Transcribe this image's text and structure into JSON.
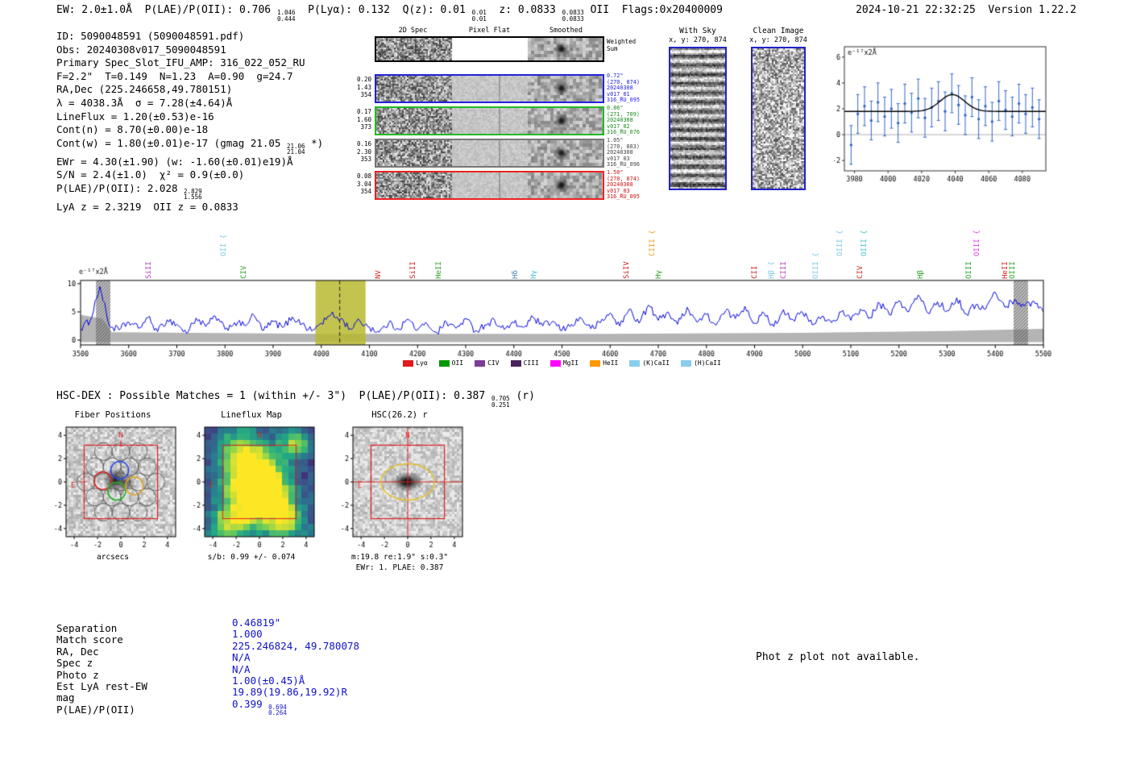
{
  "header": {
    "left_segments": [
      {
        "t": "EW: 2.0±1.0Å  P(LAE)/P(OII): 0.706 "
      },
      {
        "up": "1.046",
        "dn": "0.444"
      },
      {
        "t": "  P(Lyα): 0.132  Q(z): 0.01 "
      },
      {
        "up": "0.01",
        "dn": "0.01"
      },
      {
        "t": "  z: 0.0833 "
      },
      {
        "up": "0.0833",
        "dn": "0.0833"
      },
      {
        "t": " OII  Flags:0x20400009"
      }
    ],
    "right": "2024-10-21 22:32:25  Version 1.22.2"
  },
  "info_block": {
    "lines": [
      "ID: 5090048591 (5090048591.pdf)",
      "Obs: 20240308v017_5090048591",
      "Primary Spec_Slot_IFU_AMP: 316_022_052_RU",
      "F=2.2\"  T=0.149  N=1.23  A=0.90  g=24.7",
      "RA,Dec (225.246658,49.780151)",
      "λ = 4038.3Å  σ = 7.28(±4.64)Å",
      "LineFlux = 1.20(±0.53)e-16",
      "Cont(n) = 8.70(±0.00)e-18",
      [
        {
          "t": "Cont(w) = 1.80(±0.01)e-17 (gmag 21.05 "
        },
        {
          "up": "21.06",
          "dn": "21.04"
        },
        {
          "t": " *)"
        }
      ],
      "EWr = 4.30(±1.90) (w: -1.60(±0.01)e19)Å",
      "S/N = 2.4(±1.0)  χ² = 0.9(±0.0)",
      [
        {
          "t": "P(LAE)/P(OII): 2.028 "
        },
        {
          "up": "2.829",
          "dn": "1.556"
        }
      ],
      "LyA z = 2.3219  OII z = 0.0833"
    ]
  },
  "spec2d": {
    "col_labels": [
      "2D Spec",
      "Pixel Flat",
      "Smoothed"
    ],
    "weighted_sum_label": "Weighted Sum",
    "rows": [
      {
        "border": "#2222dd",
        "text_color": "#2222dd",
        "left": [
          "0.20",
          "1.43",
          "354"
        ],
        "right": [
          "0.72\"",
          "(270, 874)",
          "20240308",
          "v017_01",
          "316_RU_095"
        ]
      },
      {
        "border": "#22bb22",
        "text_color": "#1a8a1a",
        "left": [
          "0.17",
          "1.60",
          "373"
        ],
        "right": [
          "0.86\"",
          "(271, 709)",
          "20240308",
          "v017_02",
          "316_RU_076"
        ]
      },
      {
        "border": "#777777",
        "text_color": "#444444",
        "left": [
          "0.16",
          "2.30",
          "353"
        ],
        "right": [
          "1.05\"",
          "(270, 883)",
          "20240308",
          "v017_03",
          "316_RU_096"
        ]
      },
      {
        "border": "#ee2222",
        "text_color": "#cc1111",
        "left": [
          "0.08",
          "3.04",
          "354"
        ],
        "right": [
          "1.50\"",
          "(270, 874)",
          "20240308",
          "v017_03",
          "316_RU_095"
        ]
      }
    ]
  },
  "with_sky": {
    "title": "With Sky",
    "subtitle": "x, y: 270, 874"
  },
  "clean_image": {
    "title": "Clean Image",
    "subtitle": "x, y: 270, 874"
  },
  "hscdex_segments": [
    {
      "t": "HSC-DEX : Possible Matches = 1 (within +/- 3\")  P(LAE)/P(OII): 0.387 "
    },
    {
      "up": "0.705",
      "dn": "0.251"
    },
    {
      "t": " (r)"
    }
  ],
  "cutouts": {
    "ticks": [
      -4,
      -2,
      0,
      2,
      4
    ],
    "fiber": {
      "title": "Fiber Positions",
      "xlabel": "arcsecs",
      "compass_n": "N",
      "compass_e": "E"
    },
    "lineflux": {
      "title": "Lineflux Map",
      "caption": "s/b: 0.99 +/- 0.074"
    },
    "hsc": {
      "title": "HSC(26.2) r",
      "caption1": "m:19.8 re:1.9\" s:0.3\"",
      "caption2": "EWr: 1. PLAE: 0.387",
      "compass_n": "N",
      "compass_e": "E"
    }
  },
  "match_table": {
    "value_color": "#1111cc",
    "rows": [
      {
        "label": "Separation",
        "value": "0.46819\""
      },
      {
        "label": "Match score",
        "value": "1.000"
      },
      {
        "label": "RA, Dec",
        "value": "225.246824, 49.780078"
      },
      {
        "label": "Spec z",
        "value": "N/A"
      },
      {
        "label": "Photo z",
        "value": "N/A"
      },
      {
        "label": "Est LyA rest-EW",
        "value": "1.00(±0.45)Å"
      },
      {
        "label": "mag",
        "value": "19.89(19.86,19.92)R"
      },
      {
        "label": "P(LAE)/P(OII)",
        "value": "0.399 ",
        "up": "0.694",
        "dn": "0.264"
      }
    ]
  },
  "photz_note": "Phot z plot not available.",
  "chart_data": [
    {
      "id": "line_fit_plot",
      "type": "scatter",
      "annotation": "e⁻¹⁷x2Å",
      "xlim": [
        3974,
        4094
      ],
      "ylim": [
        -2.8,
        6.8
      ],
      "xticks": [
        3980,
        4000,
        4020,
        4040,
        4060,
        4080
      ],
      "yticks": [
        -2,
        0,
        2,
        4,
        6
      ],
      "x": [
        3978,
        3982,
        3986,
        3990,
        3994,
        3998,
        4002,
        4006,
        4010,
        4014,
        4018,
        4022,
        4026,
        4030,
        4034,
        4038,
        4042,
        4046,
        4050,
        4054,
        4058,
        4062,
        4066,
        4070,
        4074,
        4078,
        4082,
        4086,
        4090
      ],
      "y": [
        -0.8,
        1.6,
        2.2,
        1.1,
        2.5,
        1.4,
        2.0,
        0.9,
        2.4,
        1.7,
        2.8,
        1.3,
        2.1,
        2.6,
        1.8,
        3.2,
        2.3,
        1.5,
        2.9,
        1.2,
        2.2,
        1.0,
        2.6,
        1.9,
        1.4,
        2.4,
        1.6,
        2.1,
        1.2
      ],
      "yerr": 1.5,
      "point_color": "#3465c8",
      "fit": {
        "type": "gaussian",
        "mean": 4038.3,
        "sigma": 7.28,
        "continuum": 1.8,
        "amplitude": 1.3,
        "color": "#000000"
      }
    },
    {
      "id": "main_spectrum",
      "type": "line",
      "ylabel": "e⁻¹⁷x2Å",
      "xlim": [
        3500,
        5500
      ],
      "ylim": [
        -0.9,
        10.6
      ],
      "yticks": [
        0,
        5,
        10
      ],
      "xticks": [
        3500,
        3600,
        3700,
        3800,
        3900,
        4000,
        4100,
        4200,
        4300,
        4400,
        4500,
        4600,
        4700,
        4800,
        4900,
        5000,
        5100,
        5200,
        5300,
        5400,
        5500
      ],
      "x_start": 3500,
      "x_step": 20,
      "values": [
        2.0,
        3.5,
        9.5,
        2.5,
        1.8,
        3.2,
        2.1,
        4.0,
        1.5,
        3.6,
        2.8,
        1.2,
        3.9,
        2.4,
        4.2,
        1.9,
        3.1,
        2.6,
        4.4,
        1.7,
        3.3,
        2.2,
        4.1,
        2.9,
        1.6,
        3.0,
        4.5,
        3.8,
        2.0,
        3.4,
        2.3,
        1.4,
        3.0,
        2.0,
        3.7,
        1.8,
        2.9,
        1.3,
        3.2,
        2.1,
        3.8,
        1.6,
        2.7,
        3.5,
        1.9,
        3.0,
        2.2,
        4.0,
        2.5,
        3.3,
        1.7,
        2.8,
        3.9,
        2.0,
        3.1,
        4.8,
        2.5,
        5.5,
        3.0,
        6.2,
        3.5,
        5.0,
        2.8,
        5.8,
        3.2,
        4.5,
        2.6,
        5.2,
        3.8,
        6.0,
        3.0,
        4.7,
        2.4,
        5.4,
        3.6,
        4.9,
        2.7,
        4.2,
        3.1,
        5.0,
        3.5,
        5.5,
        4.0,
        6.5,
        4.5,
        7.0,
        5.0,
        8.0,
        4.8,
        6.8,
        5.2,
        7.5,
        4.6,
        6.3,
        5.5,
        8.5,
        5.8,
        7.2,
        6.0,
        6.9,
        5.0
      ],
      "line_color": "#0000dd",
      "marker_line_x": 4038.3,
      "highlight_band": {
        "x0": 3988,
        "x1": 4092,
        "color": "#b9ba30"
      },
      "hatch_bands": [
        [
          3532,
          3562
        ],
        [
          5438,
          5468
        ]
      ],
      "error_band": {
        "lower": -0.35,
        "upper": [
          [
            3500,
            4.5
          ],
          [
            3545,
            3.8
          ],
          [
            3565,
            1.4
          ],
          [
            4000,
            1.1
          ],
          [
            4600,
            1.1
          ],
          [
            5000,
            1.3
          ],
          [
            5300,
            1.6
          ],
          [
            5500,
            2.0
          ]
        ]
      },
      "emission_lines": [
        {
          "label": "SiII",
          "wl": 3642,
          "color": "#b040c0",
          "tier": 0
        },
        {
          "label": "OII {",
          "wl": 3798,
          "color": "#7ec8e3",
          "tier": 1
        },
        {
          "label": "CIV",
          "wl": 3840,
          "color": "#2aa02a",
          "tier": 0
        },
        {
          "label": "NV",
          "wl": 4119,
          "color": "#cc2222",
          "tier": 0
        },
        {
          "label": "SiII",
          "wl": 4191,
          "color": "#cc2222",
          "tier": 0
        },
        {
          "label": "HeII",
          "wl": 4245,
          "color": "#2aa02a",
          "tier": 0
        },
        {
          "label": "Hδ",
          "wl": 4404,
          "color": "#4682b4",
          "tier": 0
        },
        {
          "label": "Hγ",
          "wl": 4442,
          "color": "#45c0d0",
          "tier": 0
        },
        {
          "label": "SiIV",
          "wl": 4635,
          "color": "#cc2222",
          "tier": 0
        },
        {
          "label": "CIII {",
          "wl": 4688,
          "color": "#e8a020",
          "tier": 1
        },
        {
          "label": "Hγ",
          "wl": 4702,
          "color": "#2aa02a",
          "tier": 0
        },
        {
          "label": "CII",
          "wl": 4901,
          "color": "#cc2222",
          "tier": 0
        },
        {
          "label": "Hβ {",
          "wl": 4936,
          "color": "#7ec8e3",
          "tier": 0
        },
        {
          "label": "CIII",
          "wl": 4961,
          "color": "#b040c0",
          "tier": 0
        },
        {
          "label": "OIII {",
          "wl": 5028,
          "color": "#7ec8e3",
          "tier": 0
        },
        {
          "label": "OIII {",
          "wl": 5078,
          "color": "#7ec8e3",
          "tier": 1
        },
        {
          "label": "CIV",
          "wl": 5120,
          "color": "#cc2222",
          "tier": 0
        },
        {
          "label": "OIII {",
          "wl": 5128,
          "color": "#45c0d0",
          "tier": 1
        },
        {
          "label": "Hβ",
          "wl": 5246,
          "color": "#2aa02a",
          "tier": 0
        },
        {
          "label": "OIII",
          "wl": 5346,
          "color": "#2aa02a",
          "tier": 0
        },
        {
          "label": "OIII {",
          "wl": 5363,
          "color": "#e040e0",
          "tier": 1
        },
        {
          "label": "HeII",
          "wl": 5421,
          "color": "#cc2222",
          "tier": 0
        },
        {
          "label": "OIII",
          "wl": 5436,
          "color": "#2aa02a",
          "tier": 0
        }
      ],
      "legend": [
        {
          "label": "Lyα",
          "color": "#e41a1c"
        },
        {
          "label": "OII",
          "color": "#009900"
        },
        {
          "label": "CIV",
          "color": "#7d3c98"
        },
        {
          "label": "CIII",
          "color": "#4a235a"
        },
        {
          "label": "MgII",
          "color": "#ff00ff"
        },
        {
          "label": "HeII",
          "color": "#ff9900"
        },
        {
          "label": "(K)CaII",
          "color": "#87ceeb"
        },
        {
          "label": "(H)CaII",
          "color": "#87ceeb"
        }
      ]
    }
  ]
}
